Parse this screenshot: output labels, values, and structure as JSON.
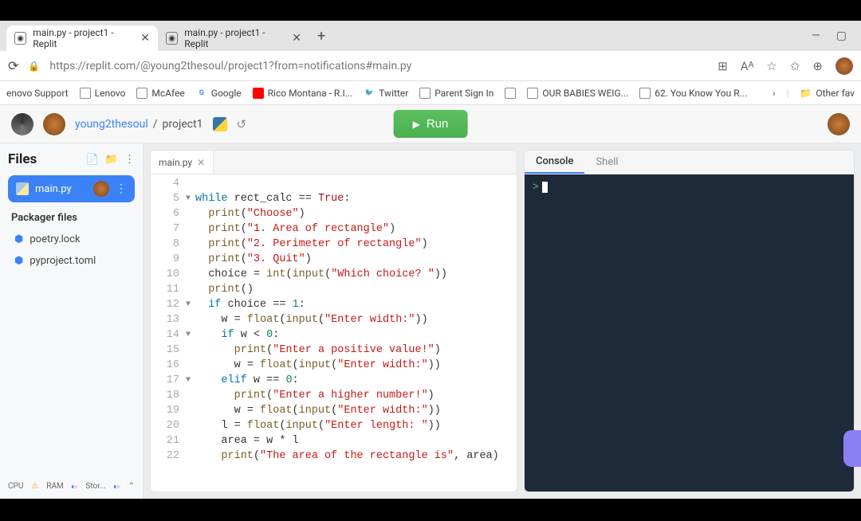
{
  "browser": {
    "tabs": [
      {
        "title": "main.py - project1 - Replit"
      },
      {
        "title": "main.py - project1 - Replit"
      }
    ],
    "url": "https://replit.com/@young2thesoul/project1?from=notifications#main.py",
    "bookmarks": [
      "enovo Support",
      "Lenovo",
      "McAfee",
      "Google",
      "Rico Montana - R.I...",
      "Twitter",
      "Parent Sign In",
      "",
      "OUR BABIES WEIG...",
      "62. You Know You R..."
    ],
    "other_fav": "Other fav"
  },
  "app": {
    "user": "young2thesoul",
    "sep": "/",
    "project": "project1",
    "run": "Run"
  },
  "files": {
    "header": "Files",
    "active": "main.py",
    "packager_header": "Packager files",
    "packager": [
      "poetry.lock",
      "pyproject.toml"
    ]
  },
  "editor": {
    "tab": "main.py",
    "lines": [
      {
        "n": 4,
        "fold": "",
        "code": ""
      },
      {
        "n": 5,
        "fold": "▼",
        "code": "while rect_calc == True:",
        "tokens": [
          [
            "kw",
            "while"
          ],
          [
            "op",
            " rect_calc "
          ],
          [
            "op",
            "=="
          ],
          [
            "op",
            " "
          ],
          [
            "bool",
            "True"
          ],
          [
            "op",
            ":"
          ]
        ]
      },
      {
        "n": 6,
        "fold": "",
        "code": "  print(\"Choose\")",
        "tokens": [
          [
            "op",
            "  "
          ],
          [
            "fn",
            "print"
          ],
          [
            "op",
            "("
          ],
          [
            "str",
            "\"Choose\""
          ],
          [
            "op",
            ")"
          ]
        ]
      },
      {
        "n": 7,
        "fold": "",
        "code": "  print(\"1. Area of rectangle\")",
        "tokens": [
          [
            "op",
            "  "
          ],
          [
            "fn",
            "print"
          ],
          [
            "op",
            "("
          ],
          [
            "str",
            "\"1. Area of rectangle\""
          ],
          [
            "op",
            ")"
          ]
        ]
      },
      {
        "n": 8,
        "fold": "",
        "code": "  print(\"2. Perimeter of rectangle\")",
        "tokens": [
          [
            "op",
            "  "
          ],
          [
            "fn",
            "print"
          ],
          [
            "op",
            "("
          ],
          [
            "str",
            "\"2. Perimeter of rectangle\""
          ],
          [
            "op",
            ")"
          ]
        ]
      },
      {
        "n": 9,
        "fold": "",
        "code": "  print(\"3. Quit\")",
        "tokens": [
          [
            "op",
            "  "
          ],
          [
            "fn",
            "print"
          ],
          [
            "op",
            "("
          ],
          [
            "str",
            "\"3. Quit\""
          ],
          [
            "op",
            ")"
          ]
        ]
      },
      {
        "n": 10,
        "fold": "",
        "code": "  choice = int(input(\"Which choice? \"))",
        "tokens": [
          [
            "op",
            "  choice "
          ],
          [
            "op",
            "="
          ],
          [
            "op",
            " "
          ],
          [
            "fn",
            "int"
          ],
          [
            "op",
            "("
          ],
          [
            "fn",
            "input"
          ],
          [
            "op",
            "("
          ],
          [
            "str",
            "\"Which choice? \""
          ],
          [
            "op",
            "))"
          ]
        ]
      },
      {
        "n": 11,
        "fold": "",
        "code": "  print()",
        "tokens": [
          [
            "op",
            "  "
          ],
          [
            "fn",
            "print"
          ],
          [
            "op",
            "()"
          ]
        ]
      },
      {
        "n": 12,
        "fold": "▼",
        "code": "  if choice == 1:",
        "tokens": [
          [
            "op",
            "  "
          ],
          [
            "kw",
            "if"
          ],
          [
            "op",
            " choice "
          ],
          [
            "op",
            "=="
          ],
          [
            "op",
            " "
          ],
          [
            "num",
            "1"
          ],
          [
            "op",
            ":"
          ]
        ]
      },
      {
        "n": 13,
        "fold": "",
        "code": "    w = float(input(\"Enter width:\"))",
        "tokens": [
          [
            "op",
            "    w "
          ],
          [
            "op",
            "="
          ],
          [
            "op",
            " "
          ],
          [
            "fn",
            "float"
          ],
          [
            "op",
            "("
          ],
          [
            "fn",
            "input"
          ],
          [
            "op",
            "("
          ],
          [
            "str",
            "\"Enter width:\""
          ],
          [
            "op",
            "))"
          ]
        ]
      },
      {
        "n": 14,
        "fold": "▼",
        "code": "    if w < 0:",
        "tokens": [
          [
            "op",
            "    "
          ],
          [
            "kw",
            "if"
          ],
          [
            "op",
            " w "
          ],
          [
            "op",
            "<"
          ],
          [
            "op",
            " "
          ],
          [
            "num",
            "0"
          ],
          [
            "op",
            ":"
          ]
        ]
      },
      {
        "n": 15,
        "fold": "",
        "code": "      print(\"Enter a positive value!\")",
        "tokens": [
          [
            "op",
            "      "
          ],
          [
            "fn",
            "print"
          ],
          [
            "op",
            "("
          ],
          [
            "str",
            "\"Enter a positive value!\""
          ],
          [
            "op",
            ")"
          ]
        ]
      },
      {
        "n": 16,
        "fold": "",
        "code": "      w = float(input(\"Enter width:\"))",
        "tokens": [
          [
            "op",
            "      w "
          ],
          [
            "op",
            "="
          ],
          [
            "op",
            " "
          ],
          [
            "fn",
            "float"
          ],
          [
            "op",
            "("
          ],
          [
            "fn",
            "input"
          ],
          [
            "op",
            "("
          ],
          [
            "str",
            "\"Enter width:\""
          ],
          [
            "op",
            "))"
          ]
        ]
      },
      {
        "n": 17,
        "fold": "▼",
        "code": "    elif w == 0:",
        "tokens": [
          [
            "op",
            "    "
          ],
          [
            "kw",
            "elif"
          ],
          [
            "op",
            " w "
          ],
          [
            "op",
            "=="
          ],
          [
            "op",
            " "
          ],
          [
            "num",
            "0"
          ],
          [
            "op",
            ":"
          ]
        ]
      },
      {
        "n": 18,
        "fold": "",
        "code": "      print(\"Enter a higher number!\")",
        "tokens": [
          [
            "op",
            "      "
          ],
          [
            "fn",
            "print"
          ],
          [
            "op",
            "("
          ],
          [
            "str",
            "\"Enter a higher number!\""
          ],
          [
            "op",
            ")"
          ]
        ]
      },
      {
        "n": 19,
        "fold": "",
        "code": "      w = float(input(\"Enter width:\"))",
        "tokens": [
          [
            "op",
            "      w "
          ],
          [
            "op",
            "="
          ],
          [
            "op",
            " "
          ],
          [
            "fn",
            "float"
          ],
          [
            "op",
            "("
          ],
          [
            "fn",
            "input"
          ],
          [
            "op",
            "("
          ],
          [
            "str",
            "\"Enter width:\""
          ],
          [
            "op",
            "))"
          ]
        ]
      },
      {
        "n": 20,
        "fold": "",
        "code": "    l = float(input(\"Enter length: \"))",
        "tokens": [
          [
            "op",
            "    l "
          ],
          [
            "op",
            "="
          ],
          [
            "op",
            " "
          ],
          [
            "fn",
            "float"
          ],
          [
            "op",
            "("
          ],
          [
            "fn",
            "input"
          ],
          [
            "op",
            "("
          ],
          [
            "str",
            "\"Enter length: \""
          ],
          [
            "op",
            "))"
          ]
        ]
      },
      {
        "n": 21,
        "fold": "",
        "code": "    area = w * l",
        "tokens": [
          [
            "op",
            "    area "
          ],
          [
            "op",
            "="
          ],
          [
            "op",
            " w "
          ],
          [
            "op",
            "*"
          ],
          [
            "op",
            " l"
          ]
        ]
      },
      {
        "n": 22,
        "fold": "",
        "code": "    print(\"The area of the rectangle is\", area)",
        "tokens": [
          [
            "op",
            "    "
          ],
          [
            "fn",
            "print"
          ],
          [
            "op",
            "("
          ],
          [
            "str",
            "\"The area of the rectangle is\""
          ],
          [
            "op",
            ", area)"
          ]
        ]
      }
    ]
  },
  "console": {
    "tab_console": "Console",
    "tab_shell": "Shell",
    "prompt": ">"
  },
  "status": {
    "cpu": "CPU",
    "ram": "RAM",
    "stor": "Stor..."
  }
}
